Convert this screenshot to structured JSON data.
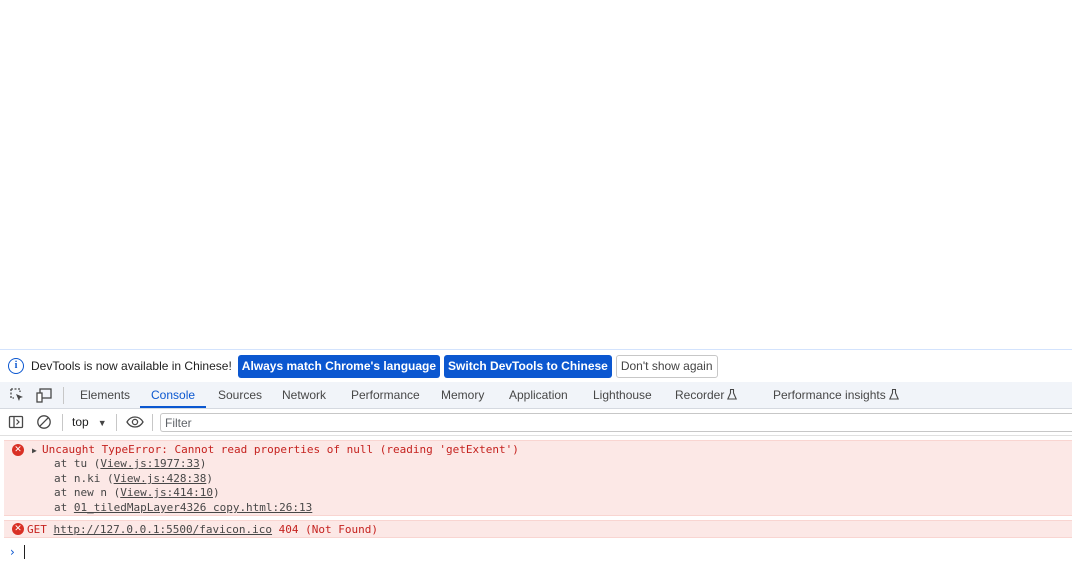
{
  "infobar": {
    "message": "DevTools is now available in Chinese!",
    "btn_match": "Always match Chrome's language",
    "btn_switch": "Switch DevTools to Chinese",
    "btn_dismiss": "Don't show again"
  },
  "tabs": [
    {
      "label": "Elements"
    },
    {
      "label": "Console"
    },
    {
      "label": "Sources"
    },
    {
      "label": "Network"
    },
    {
      "label": "Performance"
    },
    {
      "label": "Memory"
    },
    {
      "label": "Application"
    },
    {
      "label": "Lighthouse"
    },
    {
      "label": "Recorder"
    },
    {
      "label": "Performance insights"
    }
  ],
  "active_tab": "Console",
  "toolbar": {
    "context": "top",
    "filter_placeholder": "Filter"
  },
  "messages": {
    "error1": {
      "headline": "Uncaught TypeError: Cannot read properties of null (reading 'getExtent')",
      "stack": [
        {
          "prefix": "at tu (",
          "link": "View.js:1977:33",
          "suffix": ")"
        },
        {
          "prefix": "at n.ki (",
          "link": "View.js:428:38",
          "suffix": ")"
        },
        {
          "prefix": "at new n (",
          "link": "View.js:414:10",
          "suffix": ")"
        },
        {
          "prefix": "at ",
          "link": "01_tiledMapLayer4326 copy.html:26:13",
          "suffix": ""
        }
      ]
    },
    "error2": {
      "method": "GET",
      "url": "http://127.0.0.1:5500/favicon.ico",
      "status": "404 (Not Found)"
    }
  },
  "colors": {
    "accent": "#0b57d0",
    "error_bg": "#fce8e6",
    "error_text": "#c5221f"
  }
}
